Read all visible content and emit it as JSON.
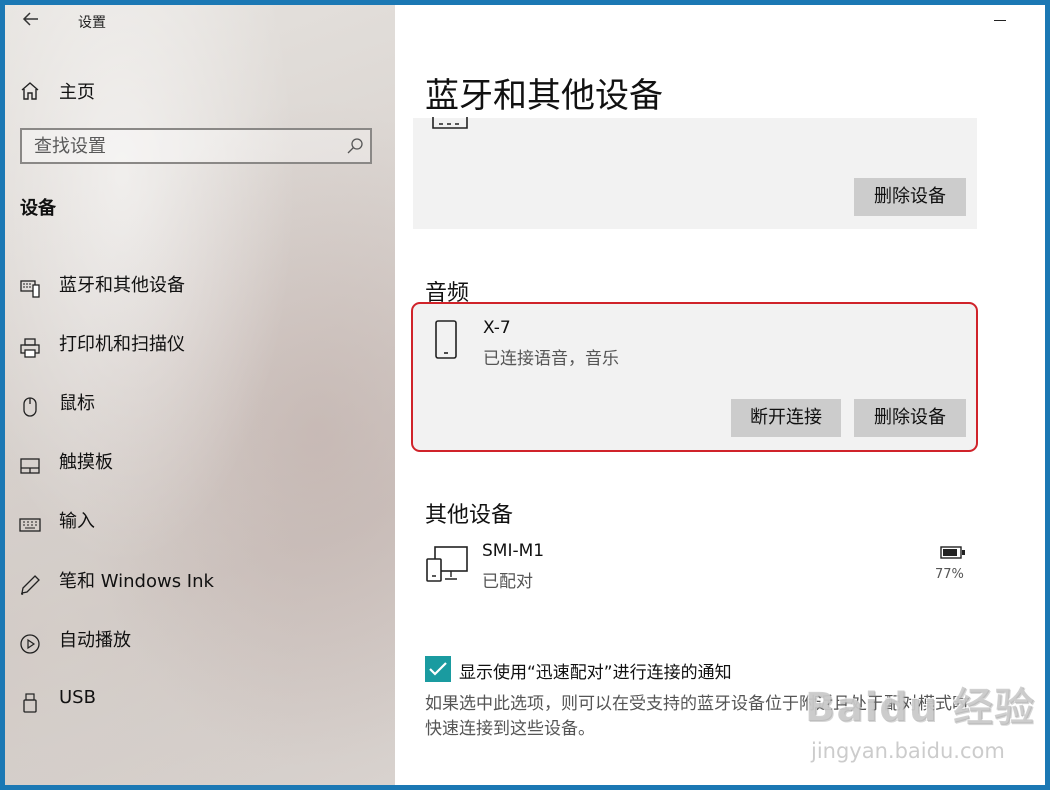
{
  "window": {
    "title": "设置",
    "back_icon": "back-arrow-icon",
    "minimize_icon": "minimize-icon"
  },
  "sidebar": {
    "home_label": "主页",
    "search_placeholder": "查找设置",
    "section_heading": "设备",
    "items": [
      {
        "label": "蓝牙和其他设备",
        "icon": "bluetooth-devices-icon"
      },
      {
        "label": "打印机和扫描仪",
        "icon": "printer-icon"
      },
      {
        "label": "鼠标",
        "icon": "mouse-icon"
      },
      {
        "label": "触摸板",
        "icon": "touchpad-icon"
      },
      {
        "label": "输入",
        "icon": "keyboard-icon"
      },
      {
        "label": "笔和 Windows Ink",
        "icon": "pen-icon"
      },
      {
        "label": "自动播放",
        "icon": "autoplay-icon"
      },
      {
        "label": "USB",
        "icon": "usb-icon"
      }
    ]
  },
  "main": {
    "title": "蓝牙和其他设备",
    "top_card": {
      "remove_label": "删除设备"
    },
    "audio": {
      "heading": "音频",
      "device_name": "X-7",
      "device_status": "已连接语音，音乐",
      "disconnect_label": "断开连接",
      "remove_label": "删除设备",
      "highlight_color": "#d0232a"
    },
    "other": {
      "heading": "其他设备",
      "device_name": "SMI-M1",
      "device_status": "已配对",
      "battery": "77%"
    },
    "swift_pair": {
      "checked": true,
      "label": "显示使用“迅速配对”进行连接的通知",
      "description": "如果选中此选项，则可以在受支持的蓝牙设备位于附近且处于配对模式时快速连接到这些设备。"
    }
  },
  "watermark": {
    "logo": "Baidu 经验",
    "url": "jingyan.baidu.com"
  },
  "colors": {
    "accent": "#1a9ba0",
    "frame": "#1b78b4",
    "card_bg": "#f2f2f2",
    "button_bg": "#cccccc"
  }
}
